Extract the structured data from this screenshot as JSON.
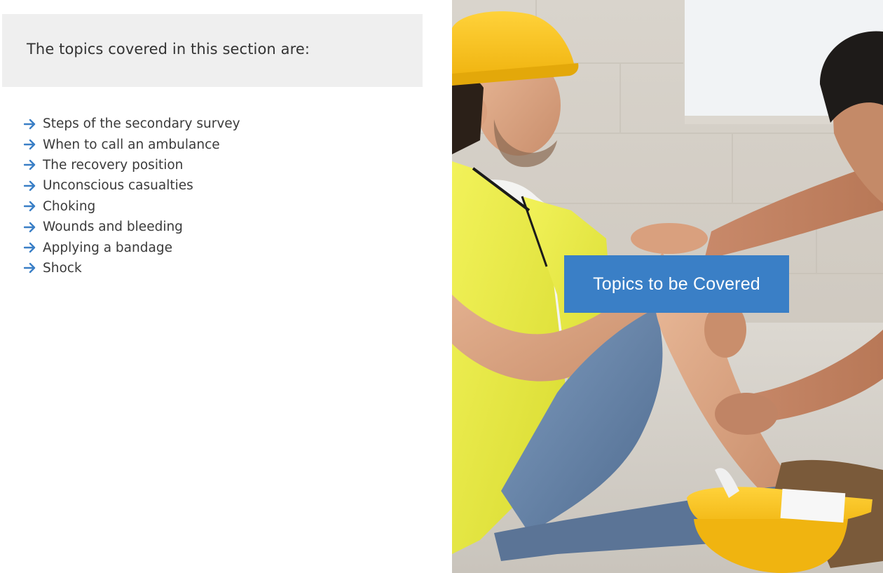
{
  "section": {
    "header": "The topics covered in this section are:",
    "topics": [
      "Steps of the secondary survey",
      "When to call an ambulance",
      "The recovery position",
      "Unconscious casualties",
      "Choking",
      "Wounds and bleeding",
      "Applying a bandage",
      "Shock"
    ],
    "bullet_icon": "arrow-right-icon",
    "bullet_color": "#3a7fc6"
  },
  "slide": {
    "title_label": "Topics to be Covered",
    "accent_color": "#3a7fc6"
  }
}
